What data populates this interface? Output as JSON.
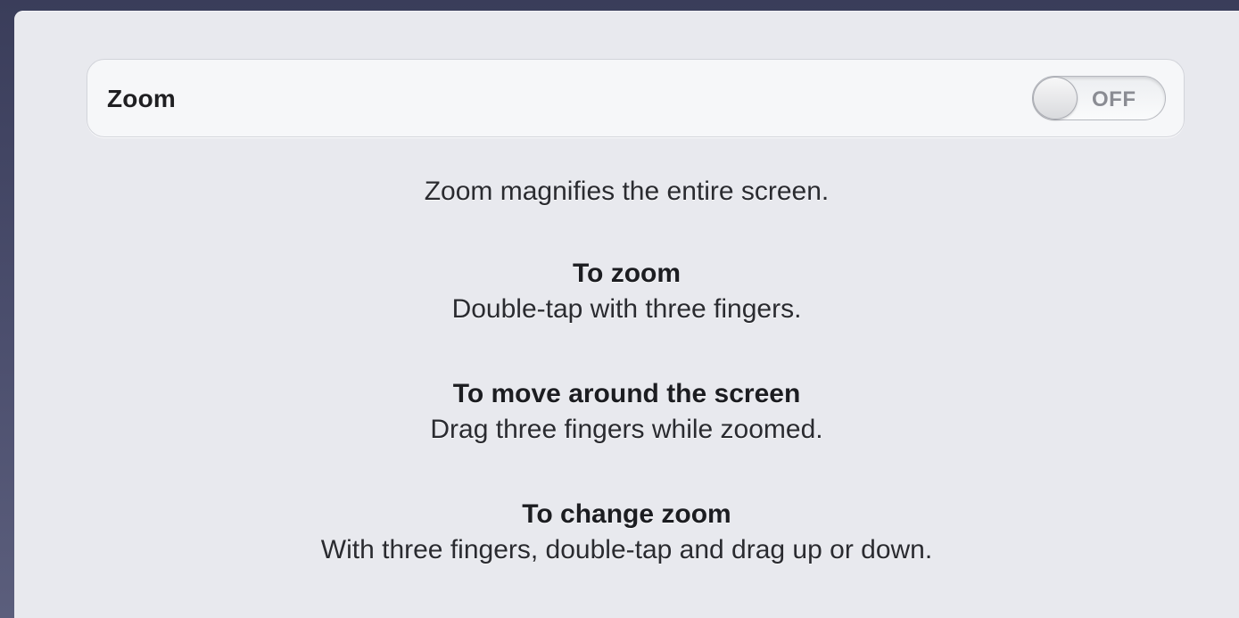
{
  "zoom_row": {
    "label": "Zoom",
    "toggle_state": "OFF"
  },
  "help": {
    "intro": "Zoom magnifies the entire screen.",
    "sections": [
      {
        "title": "To zoom",
        "description": "Double-tap with three fingers."
      },
      {
        "title": "To move around the screen",
        "description": "Drag three fingers while zoomed."
      },
      {
        "title": "To change zoom",
        "description": "With three fingers, double-tap and drag up or down."
      }
    ]
  },
  "colors": {
    "background": "#4a4d6c",
    "panel": "#e8e9ee",
    "row": "#f6f7f9",
    "toggle_text": "#8a8c93"
  }
}
